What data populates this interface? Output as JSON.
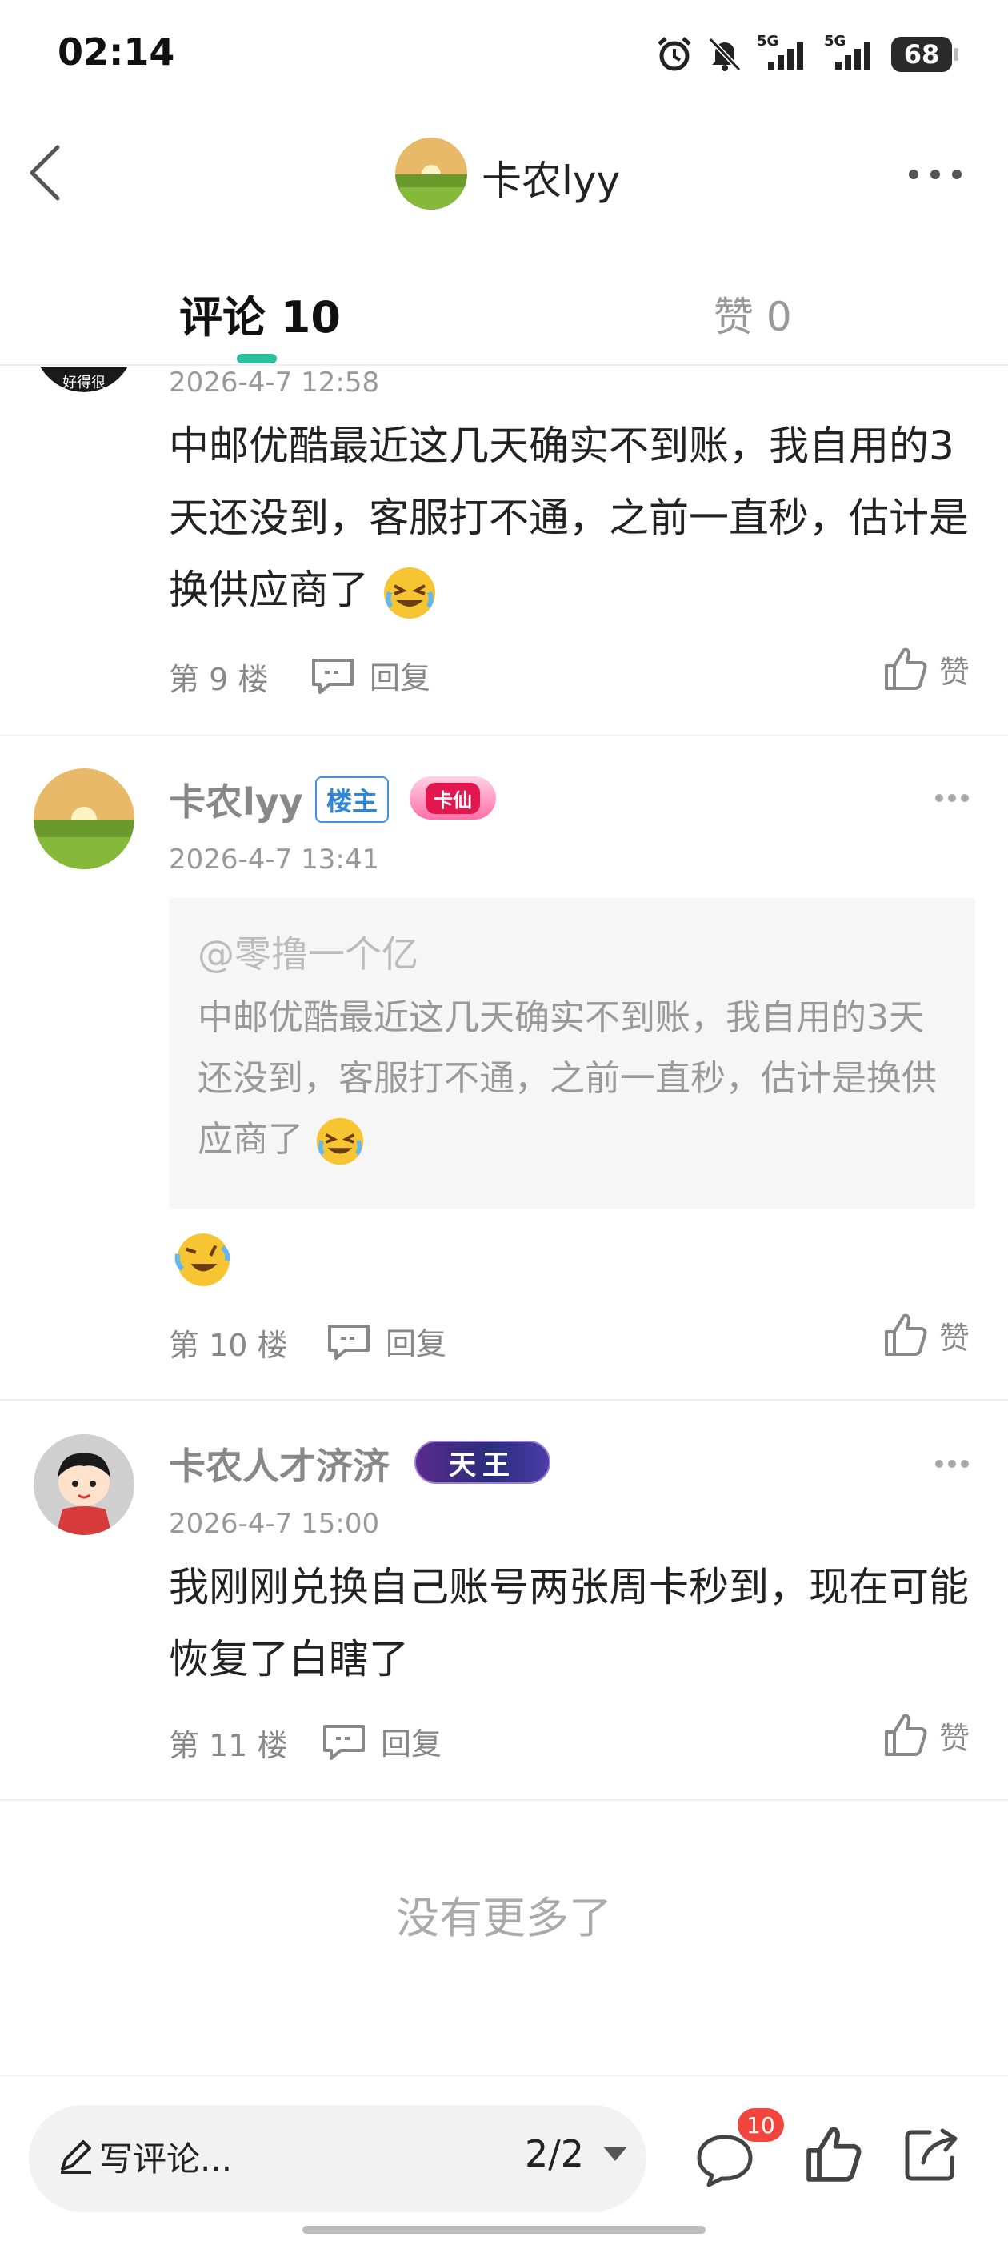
{
  "status_bar": {
    "time": "02:14",
    "signal1_label": "5G",
    "signal2_label": "5G",
    "battery": "68"
  },
  "header": {
    "title": "卡农lyy",
    "back_icon": "chevron-left-icon",
    "more_icon": "more-horizontal-icon"
  },
  "tabs": {
    "comments": "评论 10",
    "likes": "赞 0",
    "accent_color": "#2bbf9e"
  },
  "comments": [
    {
      "avatar_text": "好得很",
      "date": "2026-4-7 12:58",
      "content": "中邮优酷最近这几天确实不到账，我自用的3天还没到，客服打不通，之前一直秒，估计是换供应商了",
      "floor": "第 9 楼",
      "reply": "回复",
      "like": "赞"
    },
    {
      "username": "卡农lyy",
      "badge_owner": "楼主",
      "badge_level": "卡仙",
      "date": "2026-4-7 13:41",
      "quote_user": "@零撸一个亿",
      "quote_text": "中邮优酷最近这几天确实不到账，我自用的3天还没到，客服打不通，之前一直秒，估计是换供应商了",
      "floor": "第 10 楼",
      "reply": "回复",
      "like": "赞"
    },
    {
      "username": "卡农人才济济",
      "badge_level": "天王",
      "date": "2026-4-7 15:00",
      "content": "我刚刚兑换自己账号两张周卡秒到，现在可能恢复了白瞎了",
      "floor": "第 11 楼",
      "reply": "回复",
      "like": "赞"
    }
  ],
  "no_more": "没有更多了",
  "bottom_bar": {
    "composer_placeholder": "写评论...",
    "page_indicator": "2/2",
    "comment_count": "10"
  }
}
